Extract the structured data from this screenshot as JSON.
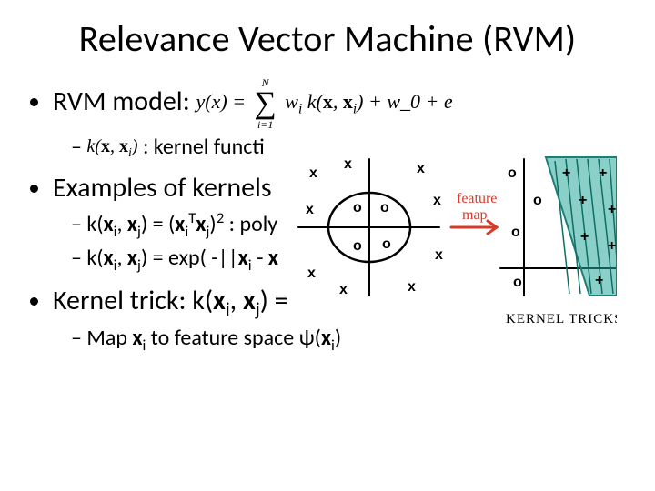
{
  "title": "Relevance Vector Machine (RVM)",
  "bullets": {
    "b1": {
      "label": "RVM model:"
    },
    "b1_eq": {
      "lhs": "y(x) =",
      "sum_top": "N",
      "sum_bot": "i=1",
      "rhs1": "w_i k(x, x_i)",
      "rhs2": "+ w_0 + e"
    },
    "b1_sub1_prefix": "",
    "b1_sub1_k": "k(x, x_i)",
    "b1_sub1_rest": ": kernel functi",
    "b2": "Examples of kernels",
    "b2_sub1": "k(x_i, x_j) = (x_i^T x_j)^2 : poly",
    "b2_sub2": "k(x_i, x_j) = exp( -||x_i - x",
    "b3": "Kernel trick: k(x_i, x_j) =",
    "b3_sub1": "Map x_i to feature space ψ(x_i)"
  },
  "illustration": {
    "label_feature_map": "feature",
    "label_feature_map2": "map",
    "caption": "KERNEL TRICKS"
  }
}
